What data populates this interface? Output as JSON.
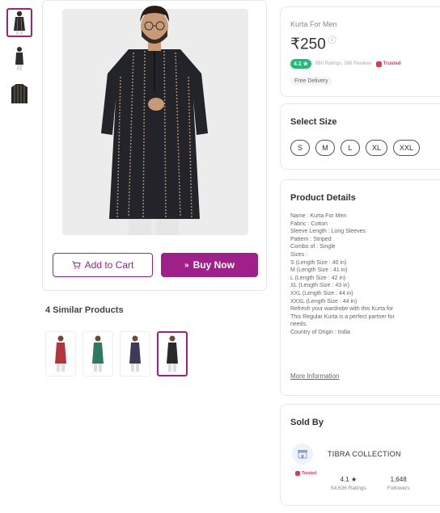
{
  "thumbnails": [
    {
      "icon": "kurta-front-thumbnail"
    },
    {
      "icon": "kurta-model-thumbnail"
    },
    {
      "icon": "kurta-fabric-thumbnail"
    }
  ],
  "actions": {
    "add_to_cart": "Add to Cart",
    "buy_now": "Buy Now"
  },
  "similar": {
    "title": "4 Similar Products",
    "colors": [
      "#b5333a",
      "#2f7a5c",
      "#3e3a5a",
      "#2a2a2a"
    ]
  },
  "product": {
    "name": "Kurta For Men",
    "price": "₹250",
    "rating": "4.1 ★",
    "rating_meta": "860 Ratings, 398 Reviews",
    "trusted": "Trusted",
    "delivery": "Free Delivery"
  },
  "size_section": {
    "title": "Select Size",
    "sizes": [
      "S",
      "M",
      "L",
      "XL",
      "XXL"
    ]
  },
  "details_section": {
    "title": "Product Details",
    "lines": [
      "Name : Kurta For Men",
      "Fabric : Cotton",
      "Sleeve Length : Long Sleeves",
      "Pattern : Striped",
      "Combo of : Single",
      "Sizes :",
      "S (Length Size : 40 in)",
      "M (Length Size : 41 in)",
      "L (Length Size : 42 in)",
      "XL (Length Size : 43 in)",
      "XXL (Length Size : 44 in)",
      "XXXL (Length Size : 44 in)",
      "Refresh your wardrobe with this Kurta for",
      "This Regular Kurta is a perfect partner for",
      "needs.",
      "Country of Origin : India"
    ],
    "more": "More Information"
  },
  "seller": {
    "title": "Sold By",
    "name": "TIBRA COLLECTION",
    "trusted": "Trusted",
    "rating": "4.1 ★",
    "rating_label": "54,636 Ratings",
    "followers": "1,648",
    "followers_label": "Followers"
  },
  "colors": {
    "accent": "#9f2089",
    "rating_green": "#23bb75",
    "trusted_red": "#e4384f"
  }
}
